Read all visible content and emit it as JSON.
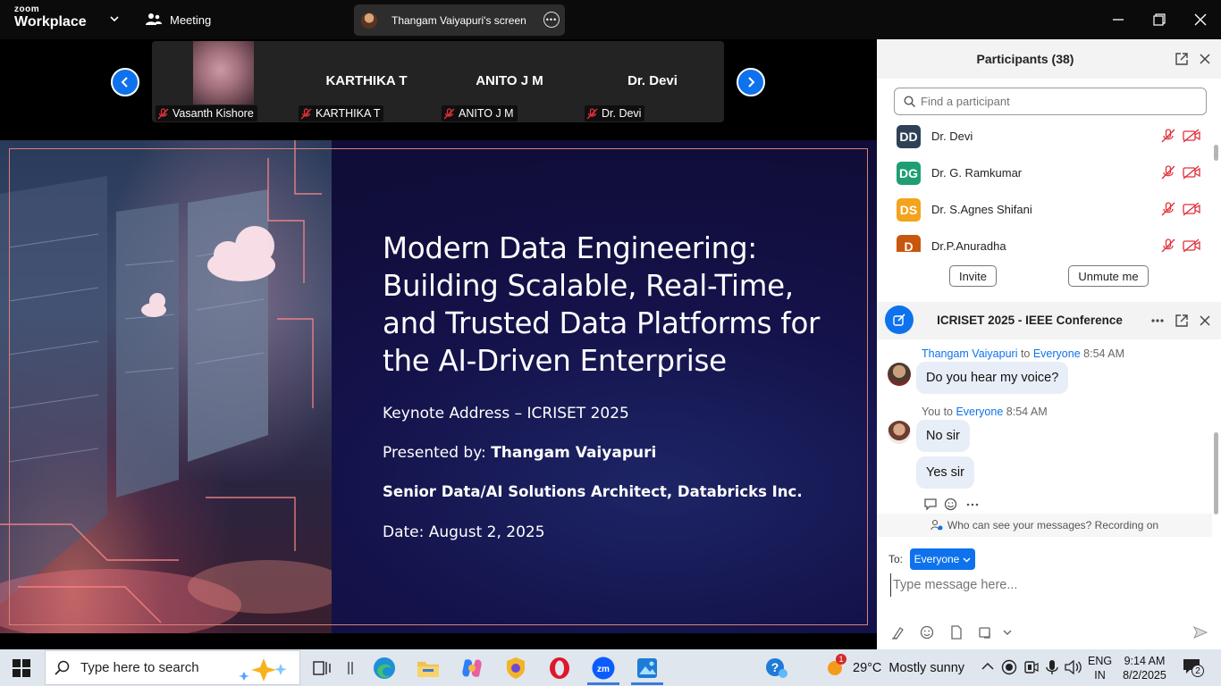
{
  "app": {
    "brand_small": "zoom",
    "brand_large": "Workplace",
    "meeting_label": "Meeting",
    "share_label": "Thangam Vaiyapuri's screen"
  },
  "video_strip": {
    "tiles": [
      {
        "big_name": "",
        "label": "Vasanth Kishore"
      },
      {
        "big_name": "KARTHIKA T",
        "label": "KARTHIKA T"
      },
      {
        "big_name": "ANITO J M",
        "label": "ANITO J M"
      },
      {
        "big_name": "Dr. Devi",
        "label": "Dr. Devi"
      }
    ]
  },
  "slide": {
    "title": "Modern Data Engineering: Building Scalable, Real-Time, and Trusted Data Platforms for the AI-Driven Enterprise",
    "keynote": "Keynote Address – ICRISET 2025",
    "presented_prefix": "Presented by: ",
    "presenter": "Thangam Vaiyapuri",
    "role": "Senior Data/AI Solutions Architect, Databricks Inc.",
    "date": "Date: August 2, 2025"
  },
  "participants": {
    "title": "Participants (38)",
    "search_placeholder": "Find a participant",
    "list": [
      {
        "initials": "DD",
        "name": "Dr. Devi",
        "color": "#2f4157"
      },
      {
        "initials": "DG",
        "name": "Dr. G. Ramkumar",
        "color": "#1f9e74"
      },
      {
        "initials": "DS",
        "name": "Dr. S.Agnes Shifani",
        "color": "#f4a31c"
      },
      {
        "initials": "D",
        "name": "Dr.P.Anuradha",
        "color": "#c9560e"
      }
    ],
    "invite_label": "Invite",
    "unmute_label": "Unmute me"
  },
  "chat": {
    "title": "ICRISET 2025 - IEEE Conference",
    "messages": [
      {
        "sender": "Thangam Vaiyapuri",
        "to_word": " to ",
        "recipient": "Everyone",
        "time": "8:54 AM",
        "texts": [
          "Do you hear my voice?"
        ]
      },
      {
        "sender": "You",
        "to_word": " to ",
        "recipient": "Everyone",
        "time": "8:54 AM",
        "texts": [
          "No sir",
          "Yes sir"
        ]
      }
    ],
    "privacy_note": "Who can see your messages? Recording on",
    "to_label": "To:",
    "to_value": "Everyone",
    "input_placeholder": "Type message here..."
  },
  "taskbar": {
    "search_placeholder": "Type here to search",
    "weather_temp": "29°C",
    "weather_text": "Mostly sunny",
    "weather_badge": "1",
    "lang_top": "ENG",
    "lang_bottom": "IN",
    "time": "9:14 AM",
    "date": "8/2/2025",
    "notif_count": "2"
  },
  "colors": {
    "accent": "#0e72ed",
    "titlebar": "#0b0b0b",
    "slide_bg": "#120f3d",
    "slide_border": "#d9827a"
  }
}
